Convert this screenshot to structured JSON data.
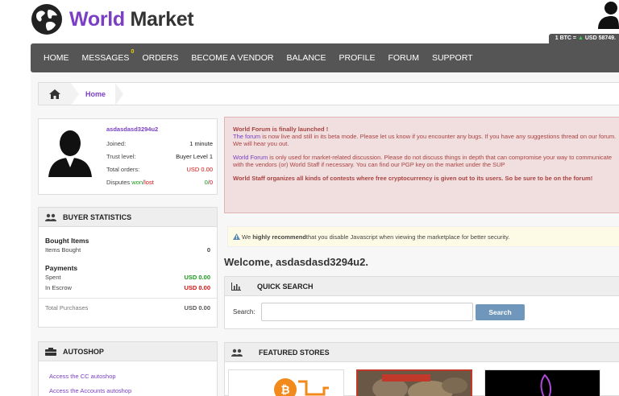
{
  "brand": {
    "name_part1": "World",
    "name_part2": "Market"
  },
  "btc_rate": {
    "prefix": "1 BTC = ",
    "arrow": "▲",
    "value": "USD 58749."
  },
  "nav": [
    {
      "label": "HOME"
    },
    {
      "label": "MESSAGES",
      "badge": "0"
    },
    {
      "label": "ORDERS"
    },
    {
      "label": "BECOME A VENDOR"
    },
    {
      "label": "BALANCE"
    },
    {
      "label": "PROFILE"
    },
    {
      "label": "FORUM"
    },
    {
      "label": "SUPPORT"
    }
  ],
  "breadcrumb": {
    "current": "Home"
  },
  "profile": {
    "username": "asdasdasd3294u2",
    "joined_label": "Joined:",
    "joined_value": "1 minute",
    "trust_label": "Trust level:",
    "trust_value": "Buyer Level 1",
    "orders_label": "Total orders:",
    "orders_value": "USD 0.00",
    "disputes_label": "Disputes",
    "disputes_won": "won",
    "disputes_sep": "/",
    "disputes_lost": "lost",
    "disputes_won_value": "0",
    "disputes_lost_value": "0"
  },
  "buyer_stats": {
    "title": "BUYER STATISTICS",
    "bought_title": "Bought Items",
    "items_bought_label": "Items Bought",
    "items_bought_value": "0",
    "payments_title": "Payments",
    "spent_label": "Spent",
    "spent_value": "USD 0.00",
    "escrow_label": "In Escrow",
    "escrow_value": "USD 0.00",
    "total_label": "Total Purchases",
    "total_value": "USD 0.00"
  },
  "autoshop": {
    "title": "AUTOSHOP",
    "links": [
      "Access the CC autoshop",
      "Access the Accounts autoshop"
    ]
  },
  "alert": {
    "title": "World Forum is finally launched !",
    "p1_link": "The forum",
    "p1_text": " is now live and still in its beta mode. Please let us know if you encounter any bugs. If you have any suggestions thread on our forum. We will hear you out.",
    "p2_link": "World Forum",
    "p2_text": " is only used for market-related discussion. Please do not discuss things in depth that can compromise your way to communicate with the vendors (or) World Staff if necessary. You can find our PGP key on the market under the SUP",
    "p3": "World Staff organizes all kinds of contests where free cryptocurrency is given out to its users. So be sure to be on the forum!"
  },
  "js_warning": {
    "pre": "We ",
    "strong": "highly recommend",
    "post": " that you disable Javascript when viewing the marketplace for better security."
  },
  "welcome": "Welcome, asdasdasd3294u2.",
  "quick_search": {
    "title": "QUICK SEARCH",
    "label": "Search:",
    "placeholder": "",
    "button": "Search"
  },
  "featured": {
    "title": "FEATURED STORES"
  },
  "colors": {
    "brand": "#7a3fc4",
    "nav": "#555555",
    "alert_bg": "#f1dede",
    "search_button": "#6f96bb",
    "green": "#1a9a1a",
    "red": "#d01010"
  },
  "icons": [
    "globe-icon",
    "user-avatar-icon",
    "home-icon",
    "users-icon",
    "cart-icon",
    "bar-chart-icon",
    "warning-icon"
  ]
}
